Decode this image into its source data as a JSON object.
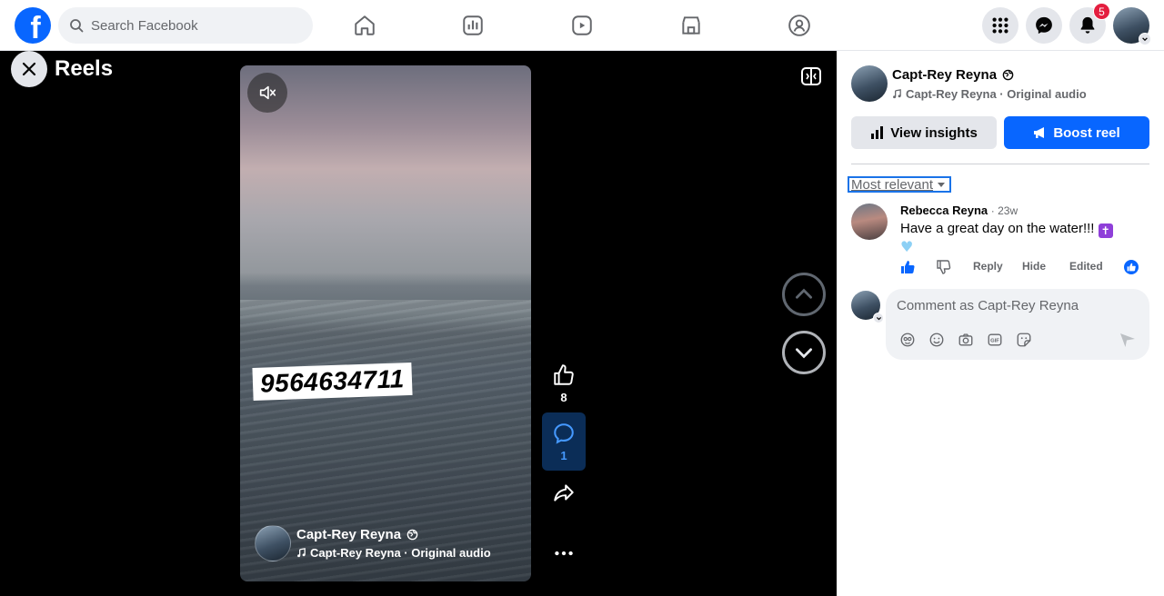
{
  "topbar": {
    "logo": "f",
    "search_placeholder": "Search Facebook",
    "notifications_count": "5"
  },
  "stage": {
    "title": "Reels",
    "overlay_text": "9564634711",
    "author_name": "Capt-Rey Reyna",
    "audio": "Capt-Rey Reyna · Original audio",
    "likes": "8",
    "comments": "1"
  },
  "panel": {
    "author_name": "Capt-Rey Reyna",
    "audio": "Capt-Rey Reyna · Original audio",
    "insights_label": "View insights",
    "boost_label": "Boost reel",
    "sort_label": "Most relevant",
    "comment": {
      "author": "Rebecca Reyna",
      "time": "23w",
      "text": "Have a great day on the water!!!",
      "reply": "Reply",
      "hide": "Hide",
      "edited": "Edited"
    },
    "compose_placeholder": "Comment as Capt-Rey Reyna"
  },
  "colors": {
    "brand": "#0866ff",
    "badge": "#e41e3f",
    "stage_bg": "#000000"
  },
  "icons": [
    "home-icon",
    "chart-icon",
    "reels-icon",
    "marketplace-icon",
    "groups-icon",
    "menu-grid-icon",
    "messenger-icon",
    "bell-icon",
    "mute-icon",
    "like-icon",
    "comment-icon",
    "share-icon",
    "more-icon",
    "globe-icon",
    "music-icon"
  ]
}
